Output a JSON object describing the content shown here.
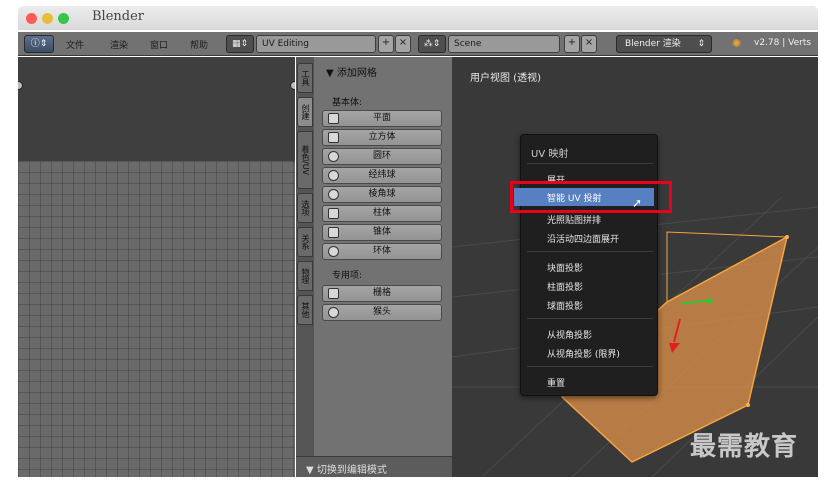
{
  "window": {
    "title": "Blender"
  },
  "header": {
    "menus": [
      "文件",
      "渲染",
      "窗口",
      "帮助"
    ],
    "layout": "UV Editing",
    "scene": "Scene",
    "engine": "Blender 渲染",
    "version": "v2.78 | Verts"
  },
  "tabs": [
    "工具",
    "创建",
    "着色/UV",
    "选项",
    "关系",
    "动画",
    "物理",
    "其他"
  ],
  "toolshelf": {
    "panel_title": "▼ 添加网格",
    "basic_label": "基本体:",
    "basic": [
      "平面",
      "立方体",
      "圆环",
      "经纬球",
      "棱角球",
      "柱体",
      "锥体",
      "环体"
    ],
    "special_label": "专用项:",
    "special": [
      "栅格",
      "猴头"
    ],
    "footer": "▼ 切换到编辑模式"
  },
  "viewport": {
    "label": "用户视图 (透视)"
  },
  "uv_menu": {
    "title": "UV 映射",
    "items": [
      "展开",
      "智能 UV 投射",
      "光照贴图拼排",
      "沿活动四边面展开",
      "块面投影",
      "柱面投影",
      "球面投影",
      "从视角投影",
      "从视角投影 (限界)",
      "重置"
    ],
    "highlighted": "智能 UV 投射"
  },
  "watermark": "最需教育",
  "colors": {
    "menu_highlight": "#5680c2",
    "annotation": "#e8001c",
    "cube": "#e8944a"
  }
}
